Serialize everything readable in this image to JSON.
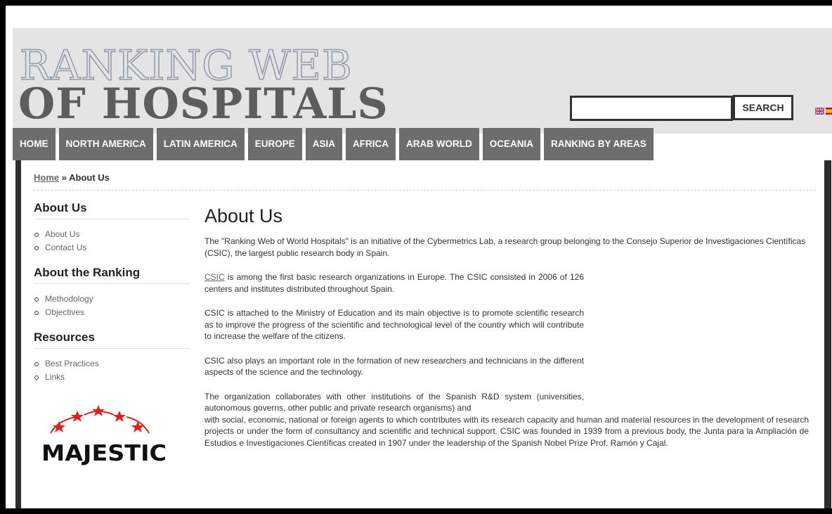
{
  "header": {
    "logo_line1": "RANKING WEB",
    "logo_line2": "OF HOSPITALS",
    "search_placeholder": "",
    "search_button": "SEARCH"
  },
  "languages": [
    {
      "code": "en",
      "icon": "uk-flag-icon"
    },
    {
      "code": "es",
      "icon": "spain-flag-icon"
    }
  ],
  "nav": {
    "items": [
      "HOME",
      "NORTH AMERICA",
      "LATIN AMERICA",
      "EUROPE",
      "ASIA",
      "AFRICA",
      "ARAB WORLD",
      "OCEANIA",
      "RANKING BY AREAS"
    ]
  },
  "breadcrumb": {
    "home": "Home",
    "separator": "»",
    "current": "About Us"
  },
  "sidebar": {
    "sections": [
      {
        "title": "About Us",
        "items": [
          "About Us",
          "Contact Us"
        ]
      },
      {
        "title": "About the Ranking",
        "items": [
          "Methodology",
          "Objectives"
        ]
      },
      {
        "title": "Resources",
        "items": [
          "Best Practices",
          "Links"
        ]
      }
    ],
    "logo_text": "MAJESTIC"
  },
  "main": {
    "title": "About Us",
    "p1": "The \"Ranking Web of World Hospitals\" is an initiative of the Cybermetrics Lab, a research group belonging to the Consejo Superior de Investigaciones Científicas (CSIC), the largest public research body in Spain.",
    "p2_link": "CSIC",
    "p2_rest": " is among the first basic research organizations in Europe. The CSIC consisted in 2006 of 126 centers and institutes distributed throughout Spain.",
    "p3": "CSIC is attached to the Ministry of Education and its main objective is to promote scientific research as to improve the progress of the scientific and technological level of the country which will contribute to increase the welfare of the citizens.",
    "p4": "CSIC also plays an important role in the formation of new researchers and technicians in the different aspects of the science and the technology.",
    "p5a": "The organization collaborates with other institutions of the Spanish R&D system (universities, autonomous governs, other public and private research organisms) and",
    "p5b": "with social, economic, national or foreign agents to which contributes with its research capacity and human and material resources in the development of research projects or under the form of consultancy and scientific and technical support. CSIC was founded in 1939 from a previous body, the Junta para la Ampliación de Estudios e Investigaciones Científicas created in 1907 under the leadership of the Spanish Nobel Prize Prof. Ramón y Cajal."
  },
  "colors": {
    "header_bg": "#e4e4e4",
    "nav_bg": "#6d6d6d",
    "logo_dark": "#5d5d5d",
    "side_bars": "#2e2e2e",
    "star_red": "#e0201b"
  }
}
